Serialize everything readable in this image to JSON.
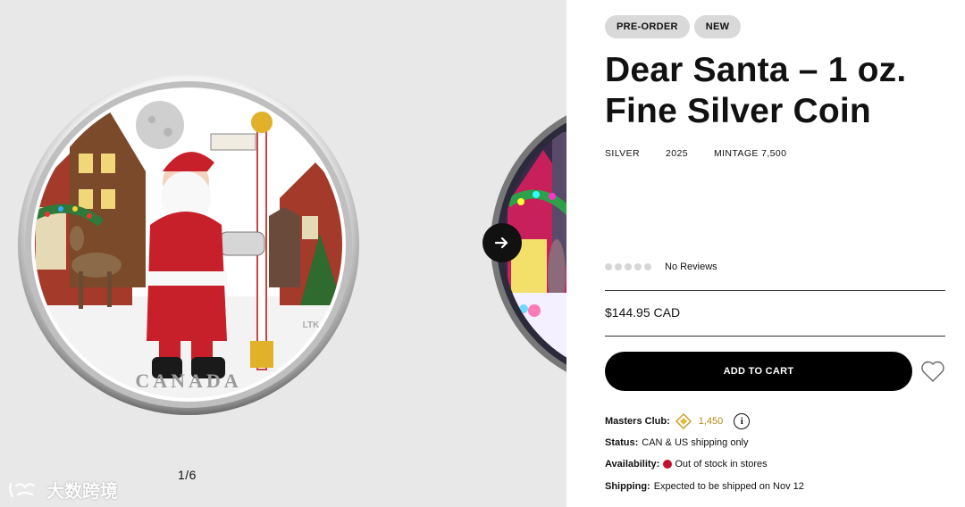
{
  "gallery": {
    "pager": "1/6",
    "coin_main_inscription": "CANADA",
    "coin_main_initials": "LTK",
    "watermark": "大数跨境"
  },
  "product": {
    "badges": [
      "PRE-ORDER",
      "NEW"
    ],
    "title_line1": "Dear Santa – 1 oz.",
    "title_line2": "Fine Silver Coin",
    "meta": {
      "metal": "SILVER",
      "year": "2025",
      "mintage": "MINTAGE 7,500"
    },
    "reviews": {
      "rating": 0,
      "label": "No Reviews"
    },
    "price": "$144.95 CAD",
    "add_to_cart": "ADD TO CART",
    "masters_club": {
      "label": "Masters Club:",
      "points": "1,450"
    },
    "status": {
      "label": "Status:",
      "value": "CAN & US shipping only"
    },
    "availability": {
      "label": "Availability:",
      "value": "Out of stock in stores"
    },
    "shipping": {
      "label": "Shipping:",
      "value": "Expected to be shipped on Nov 12"
    }
  },
  "colors": {
    "gallery_bg": "#e8e8e8",
    "badge_bg": "#d9d9d9",
    "button_bg": "#000000",
    "points_gold": "#b38a1c",
    "out_of_stock_red": "#c3122f"
  },
  "icons": [
    "arrow-right-icon",
    "star-rating-dot",
    "heart-icon",
    "diamond-points-icon",
    "info-icon",
    "stock-status-dot"
  ]
}
